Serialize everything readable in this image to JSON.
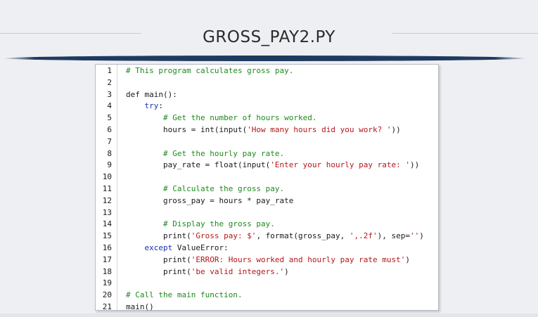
{
  "slide": {
    "title": "GROSS_PAY2.PY"
  },
  "colors": {
    "comment": "#1e8a1e",
    "keyword": "#1c2fb0",
    "string": "#b5161a",
    "accent_bar": "#1f3a60"
  },
  "code": {
    "lines": [
      {
        "n": "1",
        "tokens": [
          {
            "t": "# This program calculates gross pay.",
            "c": "c"
          }
        ]
      },
      {
        "n": "2",
        "tokens": []
      },
      {
        "n": "3",
        "tokens": [
          {
            "t": "def main():",
            "c": ""
          }
        ]
      },
      {
        "n": "4",
        "tokens": [
          {
            "t": "    ",
            "c": ""
          },
          {
            "t": "try",
            "c": "k"
          },
          {
            "t": ":",
            "c": ""
          }
        ]
      },
      {
        "n": "5",
        "tokens": [
          {
            "t": "        ",
            "c": ""
          },
          {
            "t": "# Get the number of hours worked.",
            "c": "c"
          }
        ]
      },
      {
        "n": "6",
        "tokens": [
          {
            "t": "        hours = int(input(",
            "c": ""
          },
          {
            "t": "'How many hours did you work? '",
            "c": "s"
          },
          {
            "t": "))",
            "c": ""
          }
        ]
      },
      {
        "n": "7",
        "tokens": []
      },
      {
        "n": "8",
        "tokens": [
          {
            "t": "        ",
            "c": ""
          },
          {
            "t": "# Get the hourly pay rate.",
            "c": "c"
          }
        ]
      },
      {
        "n": "9",
        "tokens": [
          {
            "t": "        pay_rate = float(input(",
            "c": ""
          },
          {
            "t": "'Enter your hourly pay rate: '",
            "c": "s"
          },
          {
            "t": "))",
            "c": ""
          }
        ]
      },
      {
        "n": "10",
        "tokens": []
      },
      {
        "n": "11",
        "tokens": [
          {
            "t": "        ",
            "c": ""
          },
          {
            "t": "# Calculate the gross pay.",
            "c": "c"
          }
        ]
      },
      {
        "n": "12",
        "tokens": [
          {
            "t": "        gross_pay = hours * pay_rate",
            "c": ""
          }
        ]
      },
      {
        "n": "13",
        "tokens": []
      },
      {
        "n": "14",
        "tokens": [
          {
            "t": "        ",
            "c": ""
          },
          {
            "t": "# Display the gross pay.",
            "c": "c"
          }
        ]
      },
      {
        "n": "15",
        "tokens": [
          {
            "t": "        print(",
            "c": ""
          },
          {
            "t": "'Gross pay: $'",
            "c": "s"
          },
          {
            "t": ", format(gross_pay, ",
            "c": ""
          },
          {
            "t": "',.2f'",
            "c": "s"
          },
          {
            "t": "), sep=",
            "c": ""
          },
          {
            "t": "''",
            "c": "s"
          },
          {
            "t": ")",
            "c": ""
          }
        ]
      },
      {
        "n": "16",
        "tokens": [
          {
            "t": "    ",
            "c": ""
          },
          {
            "t": "except",
            "c": "k"
          },
          {
            "t": " ValueError:",
            "c": ""
          }
        ]
      },
      {
        "n": "17",
        "tokens": [
          {
            "t": "        print(",
            "c": ""
          },
          {
            "t": "'ERROR: Hours worked and hourly pay rate must'",
            "c": "s"
          },
          {
            "t": ")",
            "c": ""
          }
        ]
      },
      {
        "n": "18",
        "tokens": [
          {
            "t": "        print(",
            "c": ""
          },
          {
            "t": "'be valid integers.'",
            "c": "s"
          },
          {
            "t": ")",
            "c": ""
          }
        ]
      },
      {
        "n": "19",
        "tokens": []
      },
      {
        "n": "20",
        "tokens": [
          {
            "t": "# Call the main function.",
            "c": "c"
          }
        ]
      },
      {
        "n": "21",
        "tokens": [
          {
            "t": "main()",
            "c": ""
          }
        ]
      }
    ]
  }
}
